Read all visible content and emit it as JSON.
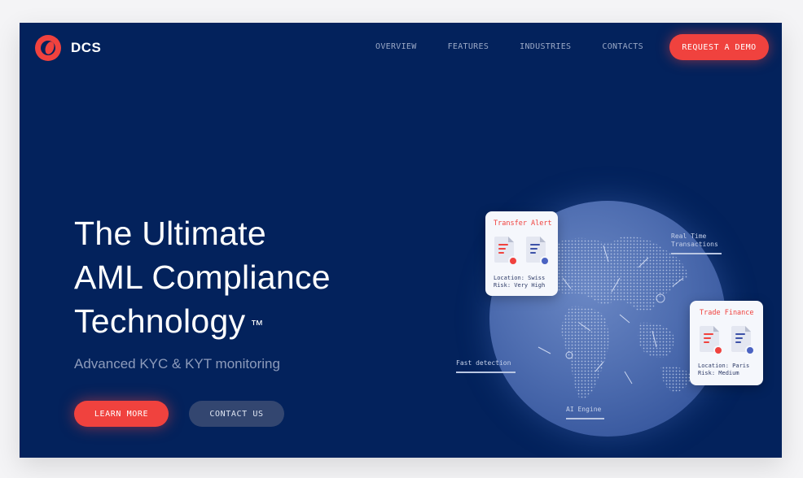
{
  "brand": {
    "name": "DCS"
  },
  "nav": {
    "items": [
      "OVERVIEW",
      "FEATURES",
      "INDUSTRIES",
      "CONTACTS"
    ],
    "cta": "REQUEST A DEMO"
  },
  "hero": {
    "title_lines": [
      "The Ultimate",
      "AML Compliance",
      "Technology"
    ],
    "trademark": "™",
    "subtitle": "Advanced KYC & KYT monitoring",
    "learn_more": "LEARN MORE",
    "contact_us": "CONTACT US"
  },
  "globe": {
    "labels": {
      "realtime_1": "Real Time",
      "realtime_2": "Transactions",
      "fast": "Fast detection",
      "ai": "AI Engine"
    }
  },
  "cards": {
    "transfer": {
      "title": "Transfer Alert",
      "location": "Location: Swiss",
      "risk": "Risk: Very High"
    },
    "trade": {
      "title": "Trade Finance",
      "location": "Location: Paris",
      "risk": "Risk: Medium"
    }
  },
  "colors": {
    "background": "#03225c",
    "accent": "#f0423e",
    "secondary_button": "#334670"
  }
}
